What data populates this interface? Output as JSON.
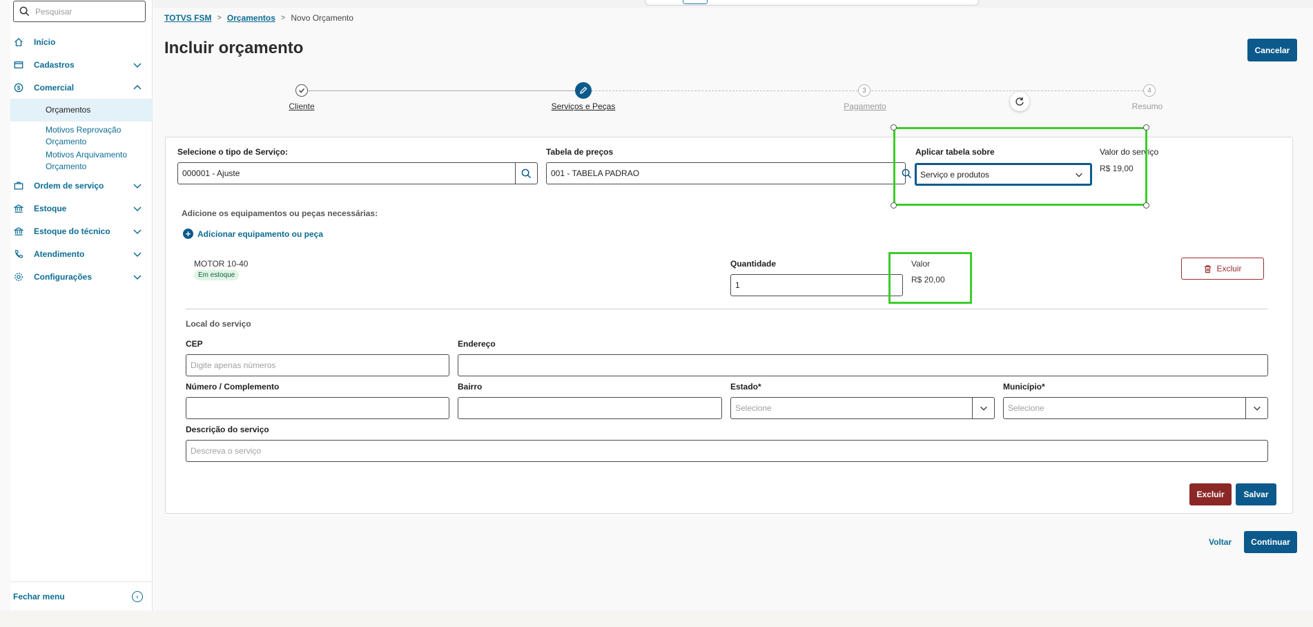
{
  "sidebar": {
    "search_placeholder": "Pesquisar",
    "items": [
      {
        "label": "Início",
        "icon": "home-icon"
      },
      {
        "label": "Cadastros",
        "icon": "cards-icon"
      },
      {
        "label": "Comercial",
        "icon": "dollar-icon"
      },
      {
        "label": "Ordem de serviço",
        "icon": "briefcase-icon"
      },
      {
        "label": "Estoque",
        "icon": "bank-icon"
      },
      {
        "label": "Estoque do técnico",
        "icon": "bank-icon"
      },
      {
        "label": "Atendimento",
        "icon": "phone-icon"
      },
      {
        "label": "Configurações",
        "icon": "gear-icon"
      }
    ],
    "sub_items": {
      "orcamentos": "Orçamentos",
      "motivos_reprovacao": "Motivos Reprovação Orçamento",
      "motivos_arquivamento": "Motivos Arquivamento Orçamento"
    },
    "footer_label": "Fechar menu"
  },
  "breadcrumb": {
    "root": "TOTVS FSM",
    "section": "Orçamentos",
    "current": "Novo Orçamento"
  },
  "page": {
    "title": "Incluir orçamento",
    "cancel_label": "Cancelar"
  },
  "stepper": {
    "steps": [
      {
        "number": "",
        "label": "Cliente",
        "state": "done"
      },
      {
        "number": "",
        "label": "Serviços e Peças",
        "state": "active"
      },
      {
        "number": "3",
        "label": "Pagamento",
        "state": "todo"
      },
      {
        "number": "4",
        "label": "Resumo",
        "state": "todo"
      }
    ]
  },
  "form": {
    "service_type": {
      "label": "Selecione o tipo de Serviço:",
      "value": "000001 - Ajuste"
    },
    "price_table": {
      "label": "Tabela de preços",
      "value": "001 - TABELA PADRAO"
    },
    "apply_table": {
      "label": "Aplicar tabela sobre",
      "value": "Serviço e produtos"
    },
    "service_value": {
      "label": "Valor do serviço",
      "value": "R$ 19,00"
    },
    "equipment_heading": "Adicione os equipamentos ou peças necessárias:",
    "add_equipment_label": "Adicionar equipamento ou peça",
    "item": {
      "name": "MOTOR 10-40",
      "stock_badge": "Em estoque",
      "quantity_label": "Quantidade",
      "quantity_value": "1",
      "value_label": "Valor",
      "value": "R$ 20,00",
      "delete_label": "Excluir"
    },
    "location": {
      "heading": "Local do serviço",
      "cep_label": "CEP",
      "cep_placeholder": "Digite apenas números",
      "address_label": "Endereço",
      "number_label": "Número / Complemento",
      "district_label": "Bairro",
      "state_label": "Estado*",
      "state_placeholder": "Selecione",
      "city_label": "Município*",
      "city_placeholder": "Selecione",
      "description_label": "Descrição do serviço",
      "description_placeholder": "Descreva o serviço"
    },
    "delete_label": "Excluir",
    "save_label": "Salvar"
  },
  "footer": {
    "back_label": "Voltar",
    "continue_label": "Continuar"
  },
  "colors": {
    "primary": "#0c5a8c",
    "link": "#0c6c94",
    "danger": "#8c2727",
    "highlight": "#3ccc2a"
  }
}
